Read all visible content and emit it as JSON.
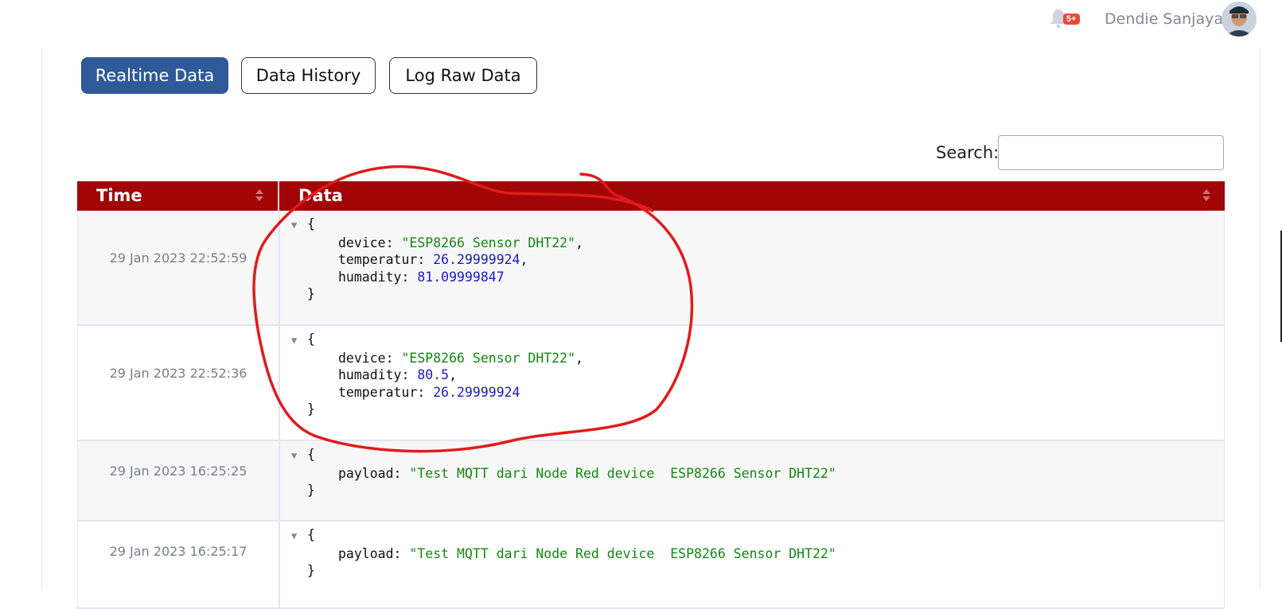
{
  "header": {
    "notification_badge": "5+",
    "user_name": "Dendie Sanjaya ..."
  },
  "tabs": [
    {
      "label": "Realtime Data",
      "active": true
    },
    {
      "label": "Data History",
      "active": false
    },
    {
      "label": "Log Raw Data",
      "active": false
    }
  ],
  "search": {
    "label": "Search:",
    "value": ""
  },
  "table": {
    "columns": [
      "Time",
      "Data"
    ],
    "rows": [
      {
        "time": "29 Jan 2023 22:52:59",
        "fields": [
          {
            "key": "device",
            "value": "\"ESP8266 Sensor DHT22\"",
            "type": "str"
          },
          {
            "key": "temperatur",
            "value": "26.29999924",
            "type": "num"
          },
          {
            "key": "humadity",
            "value": "81.09999847",
            "type": "num"
          }
        ]
      },
      {
        "time": "29 Jan 2023 22:52:36",
        "fields": [
          {
            "key": "device",
            "value": "\"ESP8266 Sensor DHT22\"",
            "type": "str"
          },
          {
            "key": "humadity",
            "value": "80.5",
            "type": "num"
          },
          {
            "key": "temperatur",
            "value": "26.29999924",
            "type": "num"
          }
        ]
      },
      {
        "time": "29 Jan 2023 16:25:25",
        "fields": [
          {
            "key": "payload",
            "value": "\"Test MQTT dari Node Red device  ESP8266 Sensor DHT22\"",
            "type": "str"
          }
        ]
      },
      {
        "time": "29 Jan 2023 16:25:17",
        "fields": [
          {
            "key": "payload",
            "value": "\"Test MQTT dari Node Red device  ESP8266 Sensor DHT22\"",
            "type": "str"
          }
        ]
      }
    ]
  },
  "json_tokens": {
    "open": "{",
    "close": "}",
    "toggle": "▼",
    "colon": ": ",
    "comma": ","
  },
  "colors": {
    "table_header": "#a10505",
    "active_tab": "#2e5a9a",
    "string_value": "#118811",
    "number_value": "#1a1acc",
    "annotation": "#e01b1b",
    "badge": "#e74a3b"
  },
  "icons": {
    "bell": "bell-icon",
    "avatar": "user-avatar",
    "toggle": "collapse-triangle-icon"
  }
}
